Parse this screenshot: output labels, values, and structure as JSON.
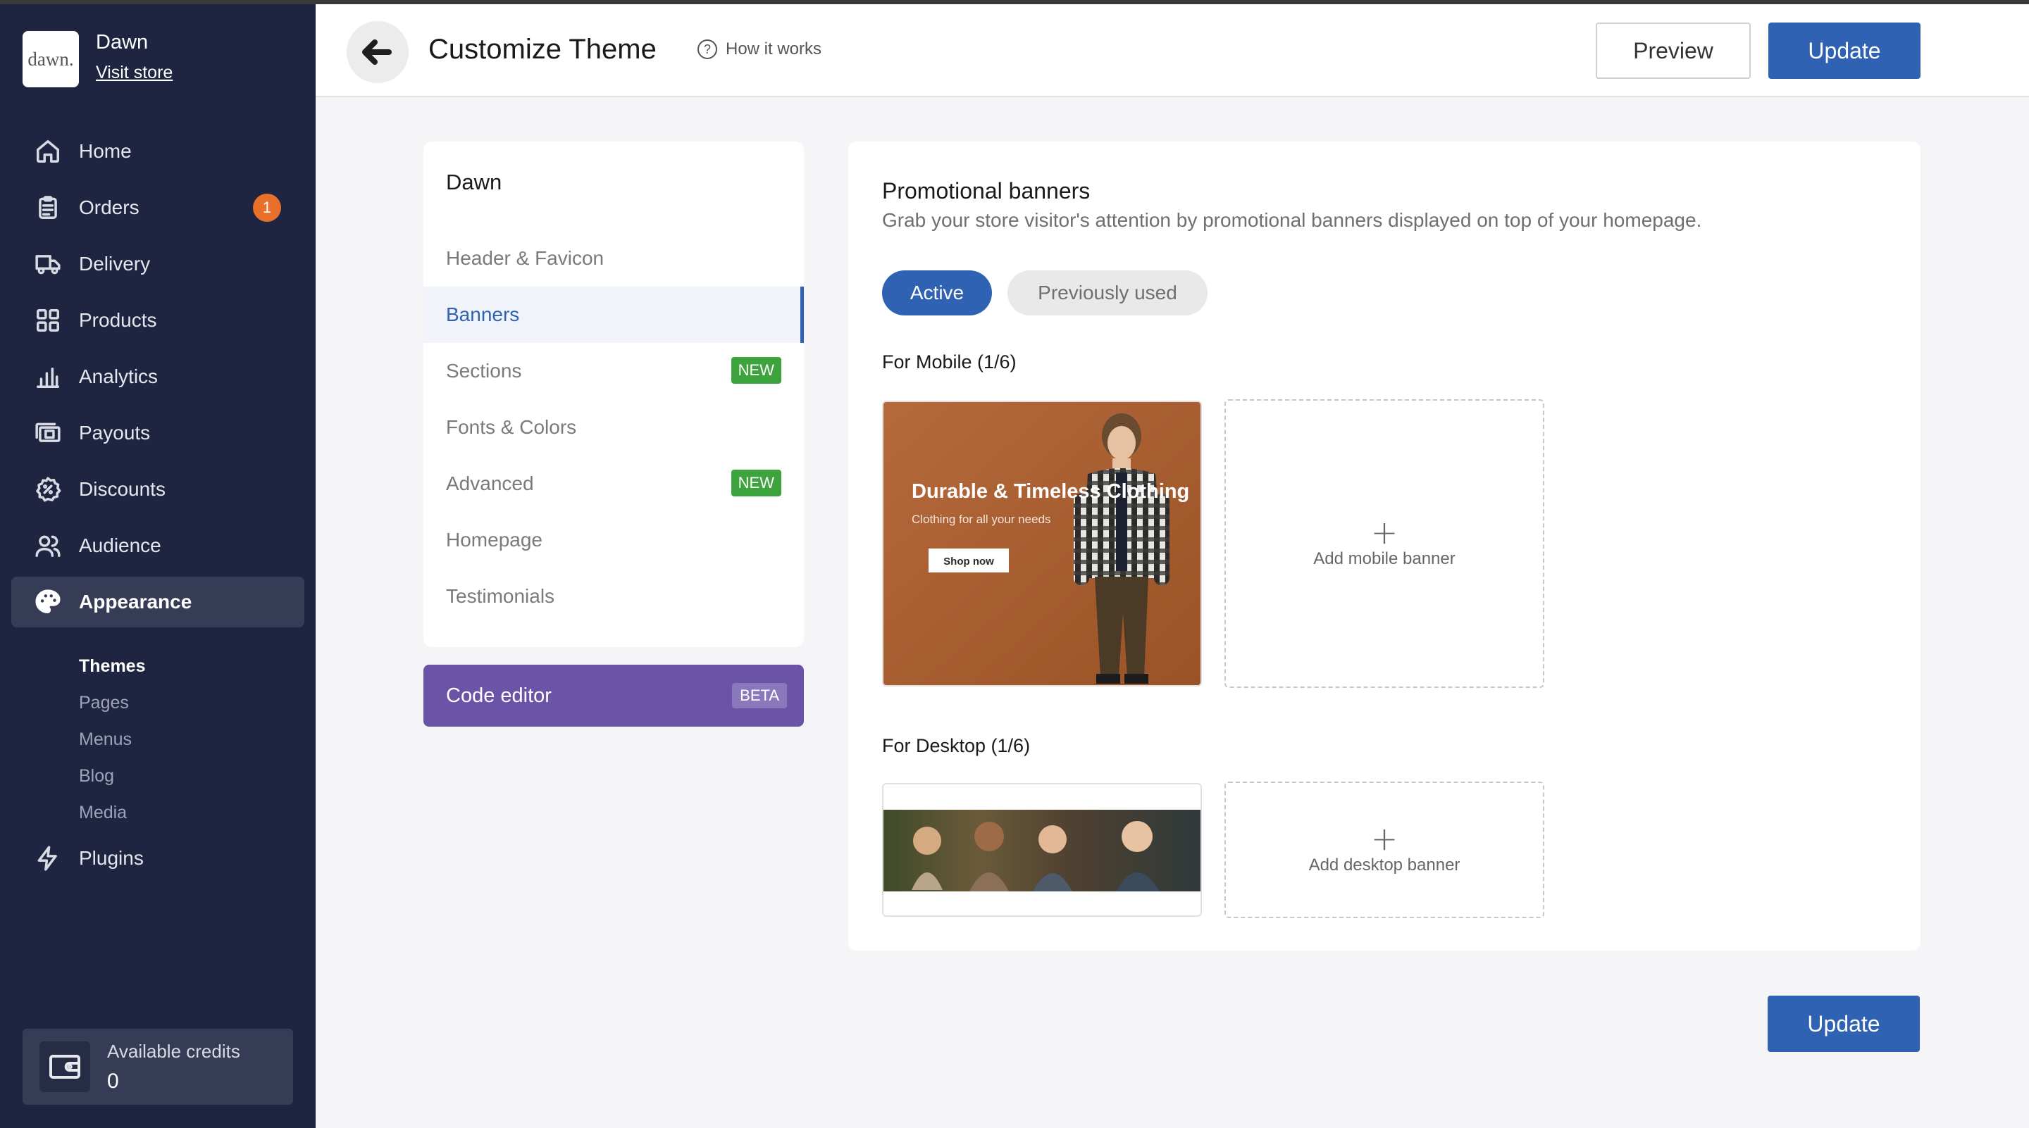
{
  "store": {
    "logo_text": "dawn.",
    "name": "Dawn",
    "visit_link": "Visit store"
  },
  "nav": [
    {
      "label": "Home",
      "icon": "home-icon"
    },
    {
      "label": "Orders",
      "icon": "clipboard-icon",
      "badge": "1"
    },
    {
      "label": "Delivery",
      "icon": "truck-icon"
    },
    {
      "label": "Products",
      "icon": "grid-icon"
    },
    {
      "label": "Analytics",
      "icon": "bar-chart-icon"
    },
    {
      "label": "Payouts",
      "icon": "wallet-cards-icon"
    },
    {
      "label": "Discounts",
      "icon": "discount-icon"
    },
    {
      "label": "Audience",
      "icon": "users-icon"
    },
    {
      "label": "Appearance",
      "icon": "palette-icon",
      "active": true
    }
  ],
  "subnav": [
    {
      "label": "Themes",
      "active": true
    },
    {
      "label": "Pages"
    },
    {
      "label": "Menus"
    },
    {
      "label": "Blog"
    },
    {
      "label": "Media"
    }
  ],
  "plugins": {
    "label": "Plugins",
    "icon": "bolt-icon"
  },
  "credits": {
    "label": "Available credits",
    "value": "0"
  },
  "header": {
    "title": "Customize Theme",
    "how_it_works": "How it works",
    "preview": "Preview",
    "update": "Update"
  },
  "theme_menu": {
    "title": "Dawn",
    "items": [
      {
        "label": "Header & Favicon"
      },
      {
        "label": "Banners",
        "active": true
      },
      {
        "label": "Sections",
        "badge": "NEW"
      },
      {
        "label": "Fonts & Colors"
      },
      {
        "label": "Advanced",
        "badge": "NEW"
      },
      {
        "label": "Homepage"
      },
      {
        "label": "Testimonials"
      }
    ]
  },
  "code_editor": {
    "label": "Code editor",
    "badge": "BETA"
  },
  "banners": {
    "title": "Promotional banners",
    "subtitle": "Grab your store visitor's attention by promotional banners displayed on top of your homepage.",
    "tab_active": "Active",
    "tab_previous": "Previously used",
    "mobile_label": "For Mobile (1/6)",
    "desktop_label": "For Desktop (1/6)",
    "add_mobile": "Add mobile banner",
    "add_desktop": "Add desktop banner",
    "mobile_banner": {
      "headline": "Durable & Timeless Clothing",
      "subline": "Clothing for all your needs",
      "cta": "Shop now"
    }
  },
  "footer": {
    "update": "Update"
  },
  "colors": {
    "sidebar_bg": "#1f2541",
    "primary": "#2f62b3",
    "code_editor": "#6b53a7",
    "new_badge": "#3da33d",
    "orders_badge": "#e8702a"
  }
}
